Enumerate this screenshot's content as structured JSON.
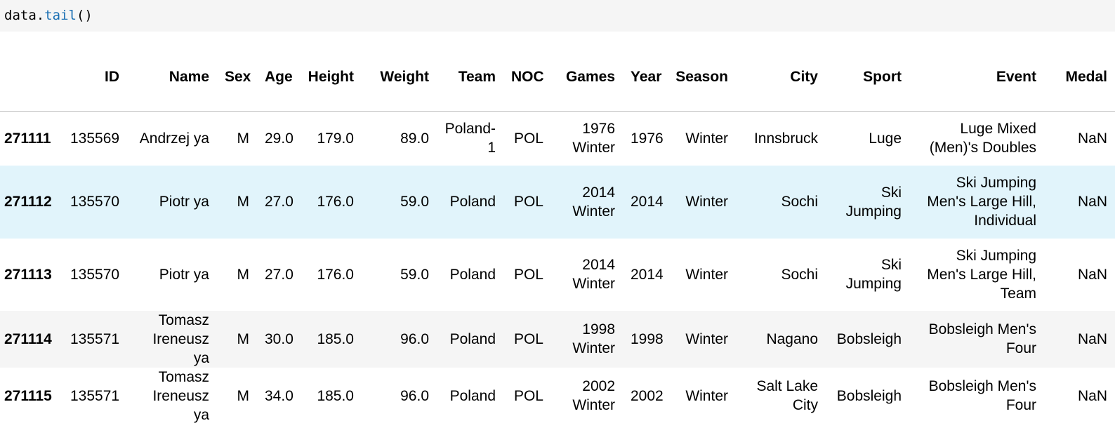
{
  "code": {
    "object": "data",
    "dot": ".",
    "method": "tail",
    "parens": "()"
  },
  "table": {
    "columns": [
      "ID",
      "Name",
      "Sex",
      "Age",
      "Height",
      "Weight",
      "Team",
      "NOC",
      "Games",
      "Year",
      "Season",
      "City",
      "Sport",
      "Event",
      "Medal"
    ],
    "rows": [
      {
        "index": "271111",
        "cells": [
          "135569",
          "Andrzej ya",
          "M",
          "29.0",
          "179.0",
          "89.0",
          "Poland-1",
          "POL",
          "1976 Winter",
          "1976",
          "Winter",
          "Innsbruck",
          "Luge",
          "Luge Mixed (Men)'s Doubles",
          "NaN"
        ]
      },
      {
        "index": "271112",
        "cells": [
          "135570",
          "Piotr ya",
          "M",
          "27.0",
          "176.0",
          "59.0",
          "Poland",
          "POL",
          "2014 Winter",
          "2014",
          "Winter",
          "Sochi",
          "Ski Jumping",
          "Ski Jumping Men's Large Hill, Individual",
          "NaN"
        ]
      },
      {
        "index": "271113",
        "cells": [
          "135570",
          "Piotr ya",
          "M",
          "27.0",
          "176.0",
          "59.0",
          "Poland",
          "POL",
          "2014 Winter",
          "2014",
          "Winter",
          "Sochi",
          "Ski Jumping",
          "Ski Jumping Men's Large Hill, Team",
          "NaN"
        ]
      },
      {
        "index": "271114",
        "cells": [
          "135571",
          "Tomasz Ireneusz ya",
          "M",
          "30.0",
          "185.0",
          "96.0",
          "Poland",
          "POL",
          "1998 Winter",
          "1998",
          "Winter",
          "Nagano",
          "Bobsleigh",
          "Bobsleigh Men's Four",
          "NaN"
        ]
      },
      {
        "index": "271115",
        "cells": [
          "135571",
          "Tomasz Ireneusz ya",
          "M",
          "34.0",
          "185.0",
          "96.0",
          "Poland",
          "POL",
          "2002 Winter",
          "2002",
          "Winter",
          "Salt Lake City",
          "Bobsleigh",
          "Bobsleigh Men's Four",
          "NaN"
        ]
      }
    ]
  }
}
